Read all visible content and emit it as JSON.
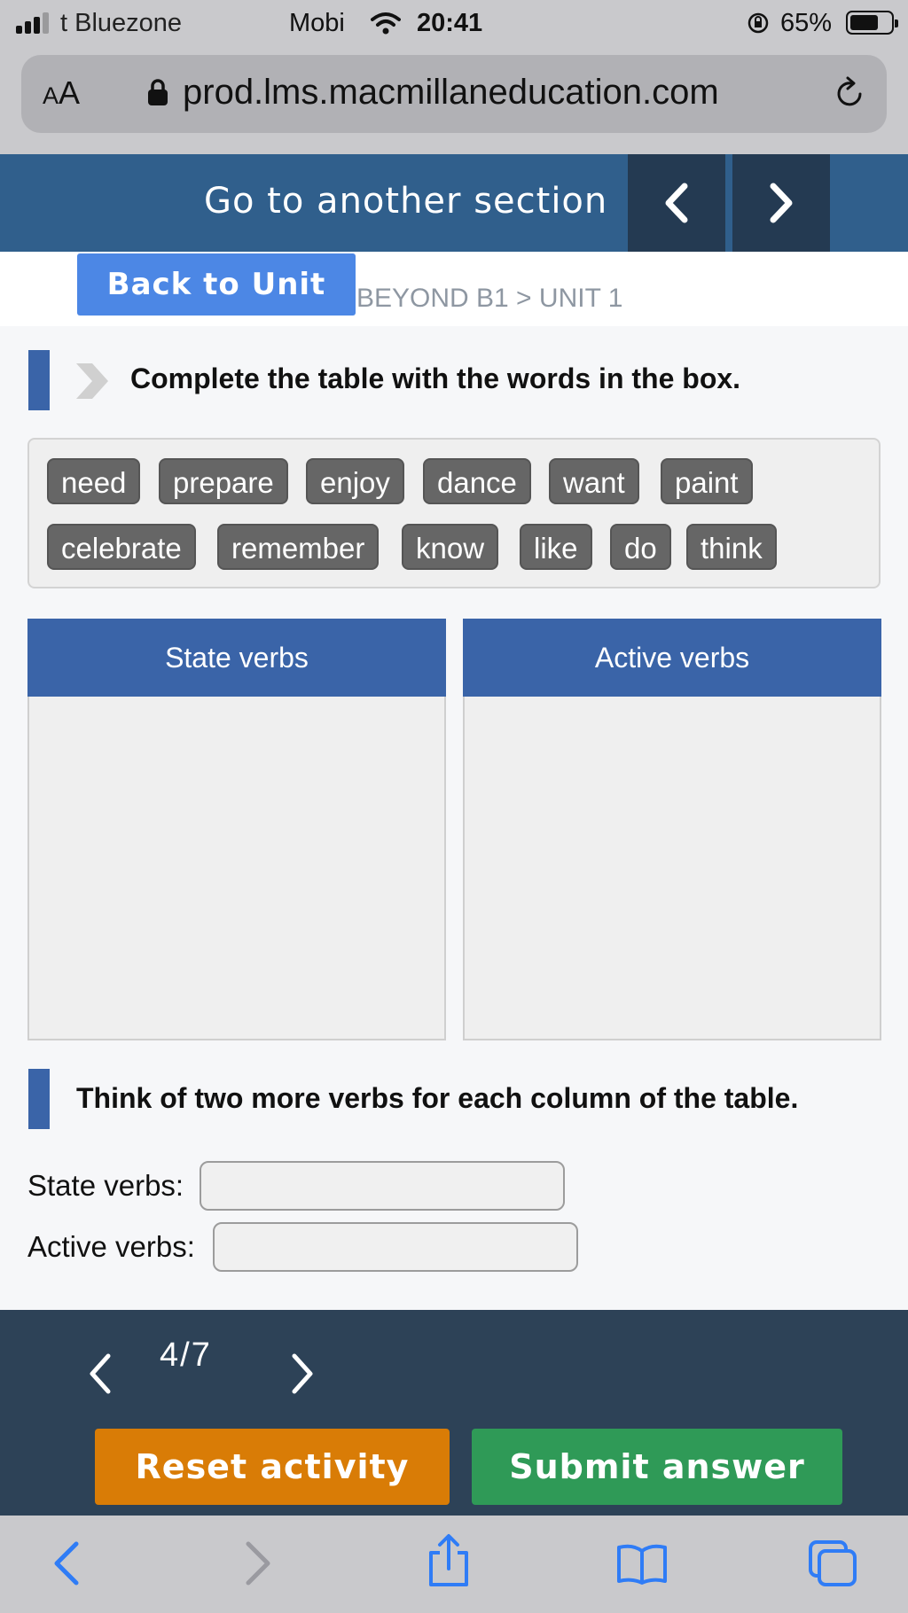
{
  "status_bar": {
    "carrier": "t Bluezone",
    "network": "Mobi",
    "time": "20:41",
    "battery_percent": "65%",
    "signal_bars_active": 3
  },
  "browser": {
    "text_size_label_big": "A",
    "text_size_label_small": "A",
    "url": "prod.lms.macmillaneducation.com"
  },
  "section_nav": {
    "title": "Go to another section"
  },
  "back": {
    "label": "Back to Unit",
    "breadcrumb": "BEYOND B1 > UNIT 1"
  },
  "activity": {
    "instruction_1": "Complete the table with the words in the box.",
    "word_box": {
      "row1": [
        "need",
        "prepare",
        "enjoy",
        "dance",
        "want",
        "paint"
      ],
      "row2": [
        "celebrate",
        "remember",
        "know",
        "like",
        "do",
        "think"
      ]
    },
    "table": {
      "col1_header": "State verbs",
      "col2_header": "Active verbs"
    },
    "instruction_2": "Think of two more verbs for each column of the table.",
    "state_label": "State verbs:",
    "active_label": "Active verbs:",
    "state_value": "",
    "active_value": ""
  },
  "footer": {
    "page_indicator": "4/7",
    "reset_label": "Reset activity",
    "submit_label": "Submit answer"
  },
  "colors": {
    "primary_blue": "#3a64a8",
    "section_bar": "#305f8c",
    "footer_bg": "#2d4257",
    "reset": "#d97c06",
    "submit": "#2f9a57",
    "back_button": "#4c87e5",
    "chip": "#666666"
  },
  "icons": {
    "back": "chevron-left-icon",
    "forward": "chevron-right-icon",
    "share": "share-icon",
    "bookmarks": "book-icon",
    "tabs": "tabs-icon",
    "reload": "reload-icon",
    "lock": "padlock-icon"
  }
}
